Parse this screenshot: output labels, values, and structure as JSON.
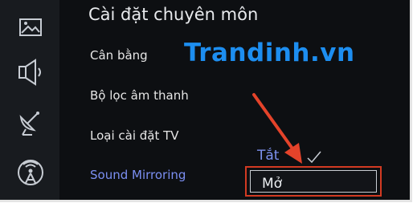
{
  "header": {
    "title": "Cài đặt chuyên môn"
  },
  "sidebar": {
    "icons": [
      {
        "name": "picture-icon"
      },
      {
        "name": "sound-icon"
      },
      {
        "name": "satellite-icon"
      },
      {
        "name": "broadcast-icon"
      }
    ]
  },
  "menu": {
    "items": [
      {
        "label": "Cân bằng"
      },
      {
        "label": "Bộ lọc âm thanh"
      },
      {
        "label": "Loại cài đặt TV"
      },
      {
        "label": "Sound Mirroring",
        "selected": true
      }
    ]
  },
  "submenu": {
    "options": [
      {
        "label": "Tắt",
        "checked": true
      },
      {
        "label": "Mở",
        "highlighted": true
      }
    ]
  },
  "watermark": {
    "text": "Trandinh.vn"
  },
  "colors": {
    "background": "#0d0f12",
    "rail": "#181b1f",
    "accent": "#7b8ff2",
    "watermark": "#1d8ef0",
    "highlight_border": "#d23a22"
  }
}
